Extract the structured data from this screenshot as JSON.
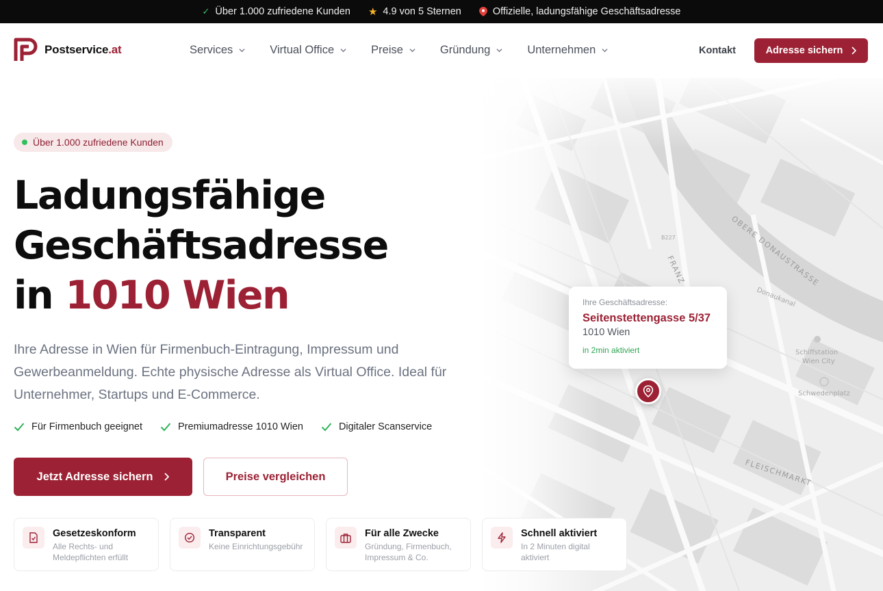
{
  "topbar": {
    "items": [
      {
        "icon": "check-icon",
        "text": "Über 1.000 zufriedene Kunden"
      },
      {
        "icon": "star-icon",
        "text": "4.9 von 5 Sternen"
      },
      {
        "icon": "pin-icon",
        "text": "Offizielle, ladungsfähige Geschäftsadresse"
      }
    ]
  },
  "nav": {
    "logo_name": "Postservice",
    "logo_tld": ".at",
    "menu": [
      "Services",
      "Virtual Office",
      "Preise",
      "Gründung",
      "Unternehmen"
    ],
    "kontakt": "Kontakt",
    "cta": "Adresse sichern"
  },
  "hero": {
    "badge": "Über 1.000 zufriedene Kunden",
    "title_line1": "Ladungsfähige",
    "title_line2": "Geschäftsadresse",
    "title_line3_prefix": "in ",
    "title_line3_accent": "1010 Wien",
    "lead": "Ihre Adresse in Wien für Firmenbuch-Eintragung, Impressum und Gewerbeanmeldung. Echte physische Adresse als Virtual Office. Ideal für Unternehmer, Startups und E-Commerce.",
    "features": [
      "Für Firmenbuch geeignet",
      "Premiumadresse 1010 Wien",
      "Digitaler Scanservice"
    ],
    "primary_button": "Jetzt Adresse sichern",
    "secondary_button": "Preise vergleichen"
  },
  "map": {
    "card_label": "Ihre Geschäftsadresse:",
    "street": "Seitenstettengasse 5/37",
    "city": "1010 Wien",
    "status": "in 2min aktiviert",
    "labels": [
      "OBERE DONAUSTRASSE",
      "FLEISCHMARKT",
      "Schiffstation",
      "Wien City",
      "Schwedenplatz",
      "Donaukanal",
      "FRANZ",
      "B227"
    ]
  },
  "cards": [
    {
      "icon": "document-check-icon",
      "title": "Gesetzeskonform",
      "desc": "Alle Rechts- und Meldepflichten erfüllt"
    },
    {
      "icon": "circle-check-icon",
      "title": "Transparent",
      "desc": "Keine Einrichtungsgebühr"
    },
    {
      "icon": "briefcase-icon",
      "title": "Für alle Zwecke",
      "desc": "Gründung, Firmenbuch, Impressum & Co."
    },
    {
      "icon": "lightning-icon",
      "title": "Schnell aktiviert",
      "desc": "In 2 Minuten digital aktiviert"
    }
  ],
  "colors": {
    "accent": "#9c2134",
    "success": "#2fc05a",
    "topbar_bg": "#0b0b0b"
  }
}
